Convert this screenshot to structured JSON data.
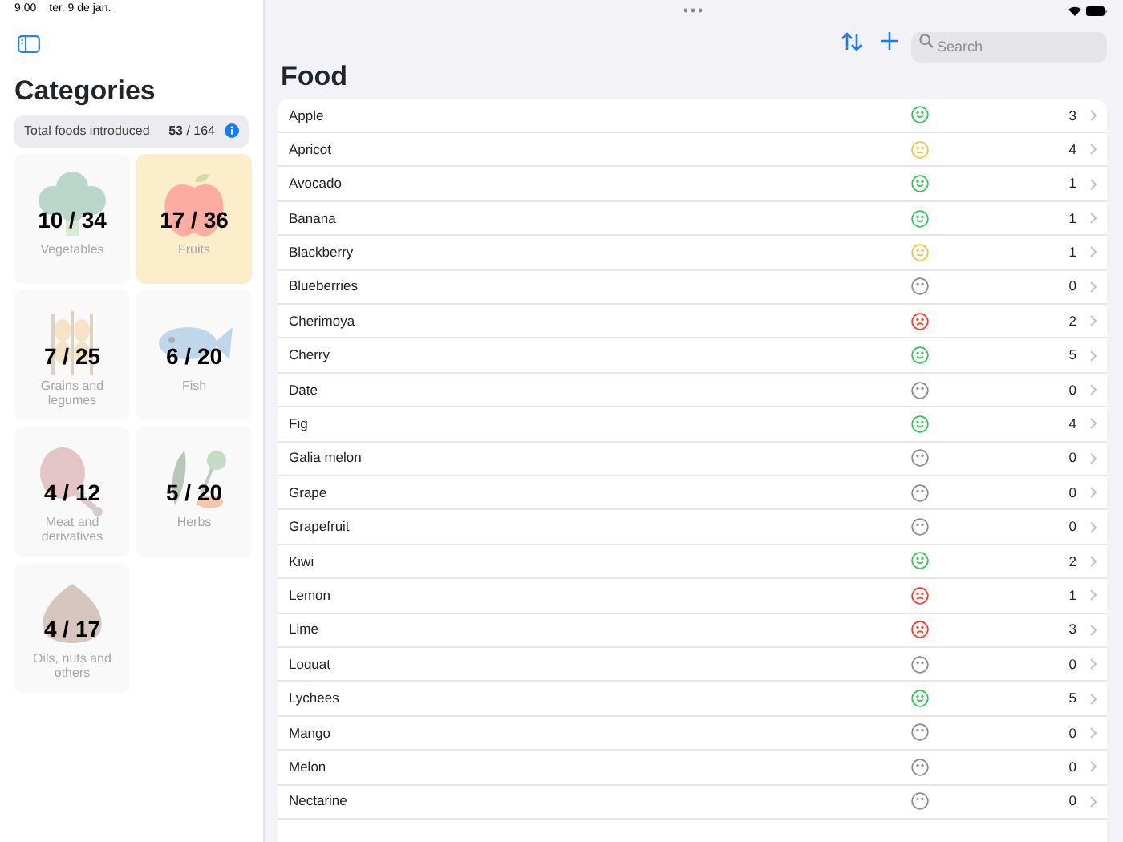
{
  "status_bar": {
    "time": "9:00",
    "date": "ter. 9 de jan."
  },
  "sidebar": {
    "title": "Categories",
    "summary": {
      "label": "Total foods introduced",
      "count": "53 / 164"
    },
    "categories": [
      {
        "kind": "vegetable",
        "count": "10 / 34",
        "name": "Vegetables",
        "selected": false
      },
      {
        "kind": "fruit",
        "count": "17 / 36",
        "name": "Fruits",
        "selected": true
      },
      {
        "kind": "grain",
        "count": "7 / 25",
        "name": "Grains and legumes",
        "selected": false
      },
      {
        "kind": "fish",
        "count": "6 / 20",
        "name": "Fish",
        "selected": false
      },
      {
        "kind": "meat",
        "count": "4 / 12",
        "name": "Meat and derivatives",
        "selected": false
      },
      {
        "kind": "herb",
        "count": "5 / 20",
        "name": "Herbs",
        "selected": false
      },
      {
        "kind": "nut",
        "count": "4 / 17",
        "name": "Oils, nuts and others",
        "selected": false
      }
    ]
  },
  "main": {
    "title": "Food",
    "search": {
      "placeholder": "Search"
    },
    "foods": [
      {
        "name": "Apple",
        "kind": "happy",
        "count": "3"
      },
      {
        "name": "Apricot",
        "kind": "neutral",
        "count": "4"
      },
      {
        "name": "Avocado",
        "kind": "happy",
        "count": "1"
      },
      {
        "name": "Banana",
        "kind": "happy",
        "count": "1"
      },
      {
        "name": "Blackberry",
        "kind": "neutral",
        "count": "1"
      },
      {
        "name": "Blueberries",
        "kind": "untried",
        "count": "0"
      },
      {
        "name": "Cherimoya",
        "kind": "sad",
        "count": "2"
      },
      {
        "name": "Cherry",
        "kind": "happy",
        "count": "5"
      },
      {
        "name": "Date",
        "kind": "untried",
        "count": "0"
      },
      {
        "name": "Fig",
        "kind": "happy",
        "count": "4"
      },
      {
        "name": "Galia melon",
        "kind": "untried",
        "count": "0"
      },
      {
        "name": "Grape",
        "kind": "untried",
        "count": "0"
      },
      {
        "name": "Grapefruit",
        "kind": "untried",
        "count": "0"
      },
      {
        "name": "Kiwi",
        "kind": "happy",
        "count": "2"
      },
      {
        "name": "Lemon",
        "kind": "sad",
        "count": "1"
      },
      {
        "name": "Lime",
        "kind": "sad",
        "count": "3"
      },
      {
        "name": "Loquat",
        "kind": "untried",
        "count": "0"
      },
      {
        "name": "Lychees",
        "kind": "happy",
        "count": "5"
      },
      {
        "name": "Mango",
        "kind": "untried",
        "count": "0"
      },
      {
        "name": "Melon",
        "kind": "untried",
        "count": "0"
      },
      {
        "name": "Nectarine",
        "kind": "untried",
        "count": "0"
      }
    ]
  }
}
